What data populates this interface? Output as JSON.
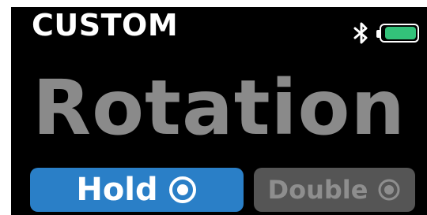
{
  "header": {
    "title": "CUSTOM"
  },
  "status": {
    "bluetooth_icon": "bluetooth-icon",
    "battery_icon": "battery-icon",
    "battery_level": 0.92,
    "battery_color": "#33c27a"
  },
  "main": {
    "mode_label": "Rotation"
  },
  "buttons": {
    "hold": {
      "label": "Hold",
      "icon": "target-icon",
      "color": "#2a7fc7"
    },
    "double": {
      "label": "Double",
      "icon": "target-icon",
      "color": "#555555"
    }
  }
}
